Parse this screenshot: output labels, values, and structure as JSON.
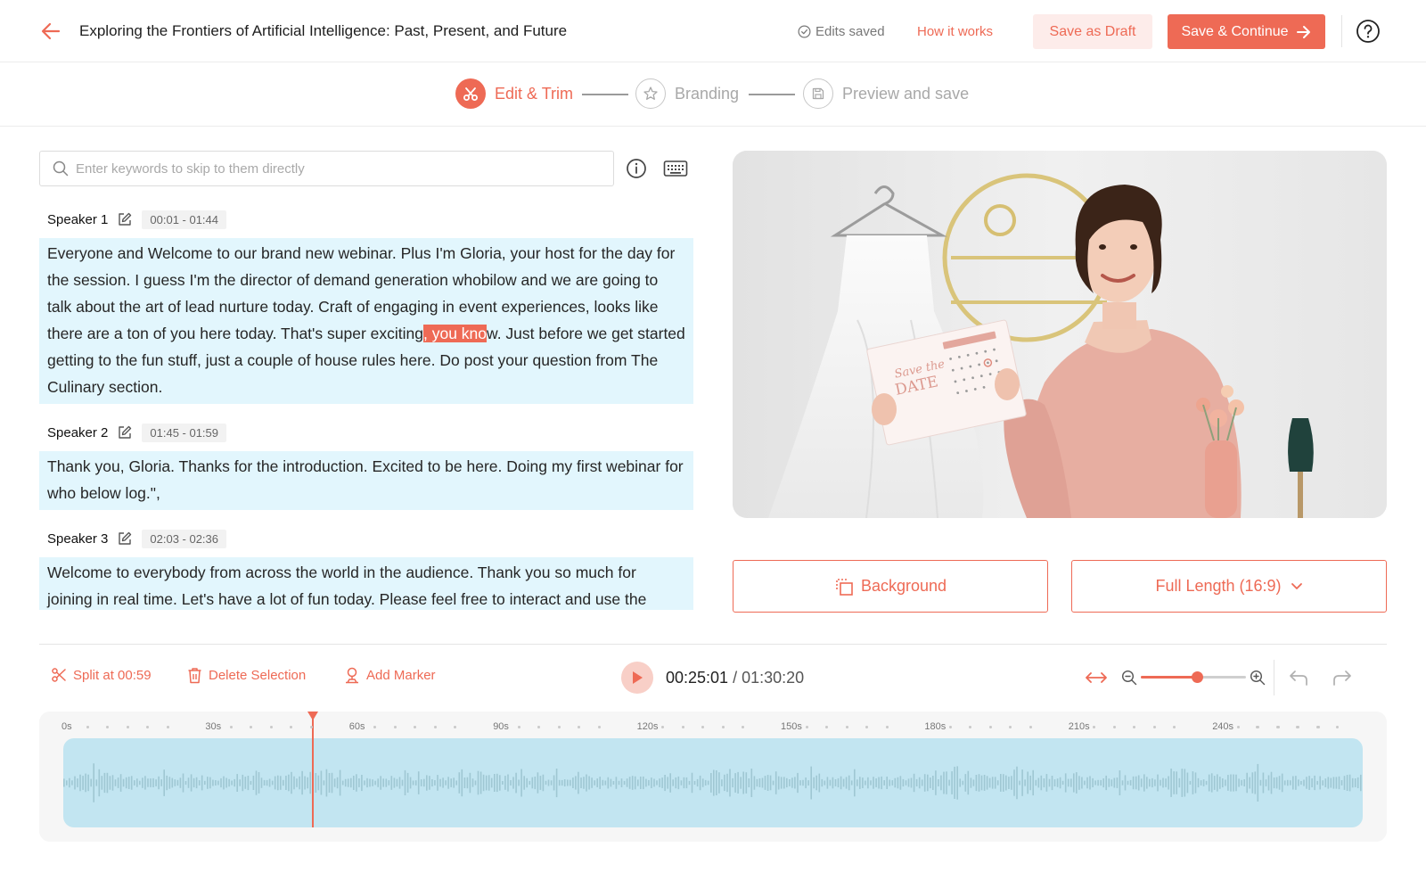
{
  "header": {
    "title": "Exploring the Frontiers of Artificial Intelligence: Past, Present, and Future",
    "saved_status": "Edits saved",
    "how_it_works": "How it works",
    "save_draft": "Save as Draft",
    "save_continue": "Save & Continue"
  },
  "steps": [
    {
      "label": "Edit & Trim",
      "state": "active",
      "icon": "scissors-icon"
    },
    {
      "label": "Branding",
      "state": "inactive",
      "icon": "star-icon"
    },
    {
      "label": "Preview and save",
      "state": "inactive",
      "icon": "save-icon"
    }
  ],
  "search": {
    "placeholder": "Enter keywords to skip to them directly"
  },
  "transcript": [
    {
      "speaker": "Speaker 1",
      "time": "00:01 - 01:44",
      "text_before": "Everyone and Welcome to our brand new webinar. Plus I'm Gloria, your host for the day for the session. I guess I'm the director of demand generation whobilow and we are going to talk about the art of lead nurture today. Craft of engaging in event experiences, looks like there are a ton of you here today. That's super exciting",
      "highlight": ", you kno",
      "text_after": "w. Just before we get started getting to the fun stuff, just a couple of house rules here. Do post your question from The Culinary section."
    },
    {
      "speaker": "Speaker 2",
      "time": "01:45 - 01:59",
      "text": "Thank you, Gloria. Thanks for the introduction. Excited to be here. Doing my first webinar for who below log.\","
    },
    {
      "speaker": "Speaker 3",
      "time": "02:03 - 02:36",
      "text": "Welcome to everybody from across the world in the audience. Thank you so much for joining in real time. Let's have a lot of fun today. Please feel free to interact and use the"
    }
  ],
  "video": {
    "card_script": "Save the",
    "card_title": "DATE"
  },
  "controls": {
    "background": "Background",
    "length": "Full Length (16:9)"
  },
  "toolbar": {
    "split": "Split at 00:59",
    "delete": "Delete Selection",
    "marker": "Add Marker",
    "current_time": "00:25:01",
    "total_time": " / 01:30:20",
    "zoom_level": 0.53
  },
  "timeline": {
    "labels": [
      "0s",
      "30s",
      "60s",
      "90s",
      "120s",
      "150s",
      "180s",
      "210s",
      "240s"
    ],
    "playhead_seconds": 52
  },
  "colors": {
    "accent": "#ee6a55",
    "accent_light": "#fdecea",
    "transcript_bg": "#e2f6fd",
    "wave_bg": "#c2e5f1"
  }
}
